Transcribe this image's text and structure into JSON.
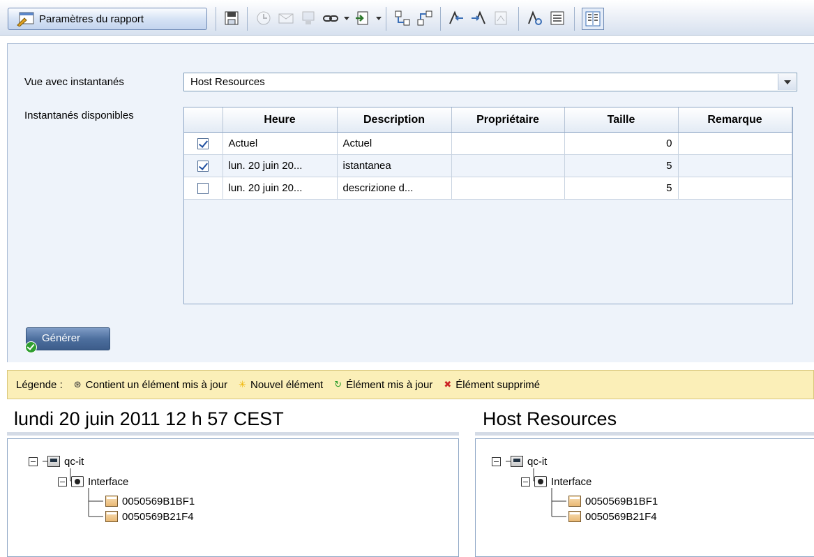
{
  "toolbar": {
    "report_settings_label": "Paramètres du rapport",
    "icons": [
      "save-icon",
      "schedule-icon",
      "email-icon",
      "export-icon",
      "link-icon",
      "import-icon",
      "expand-all-icon",
      "collapse-all-icon",
      "previous-change-icon",
      "next-change-icon",
      "report-icon",
      "find-icon",
      "details-icon",
      "side-by-side-icon"
    ]
  },
  "form": {
    "view_label": "Vue avec instantanés",
    "view_value": "Host Resources",
    "snapshots_label": "Instantanés disponibles",
    "columns": [
      "",
      "Heure",
      "Description",
      "Propriétaire",
      "Taille",
      "Remarque"
    ],
    "rows": [
      {
        "checked": true,
        "heure": "Actuel",
        "description": "Actuel",
        "proprietaire": "",
        "taille": "0",
        "remarque": ""
      },
      {
        "checked": true,
        "heure": "lun. 20 juin 20...",
        "description": "istantanea",
        "proprietaire": "",
        "taille": "5",
        "remarque": ""
      },
      {
        "checked": false,
        "heure": "lun. 20 juin 20...",
        "description": "descrizione d...",
        "proprietaire": "",
        "taille": "5",
        "remarque": ""
      }
    ],
    "generate_label": "Générer"
  },
  "legend": {
    "label": "Légende :",
    "items": [
      {
        "symbol": "⊛",
        "text": "Contient un élément mis à jour",
        "color": "#333333"
      },
      {
        "symbol": "✳",
        "text": "Nouvel élément",
        "color": "#f0b400"
      },
      {
        "symbol": "↻",
        "text": "Élément mis à jour",
        "color": "#2e9e2e"
      },
      {
        "symbol": "✖",
        "text": "Élément supprimé",
        "color": "#cc2222"
      }
    ]
  },
  "panes": [
    {
      "title": "lundi 20 juin 2011 12 h 57 CEST",
      "root": "qc-it",
      "child": "Interface",
      "leaves": [
        "0050569B1BF1",
        "0050569B21F4"
      ]
    },
    {
      "title": "Host Resources",
      "root": "qc-it",
      "child": "Interface",
      "leaves": [
        "0050569B1BF1",
        "0050569B21F4"
      ]
    }
  ]
}
